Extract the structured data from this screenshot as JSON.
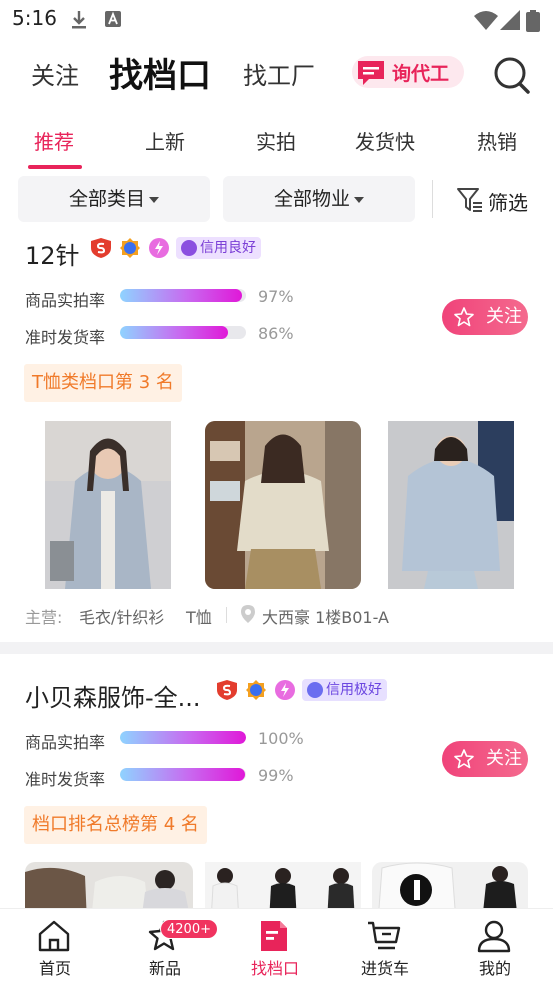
{
  "status": {
    "time": "5:16"
  },
  "topnav": {
    "follow": "关注",
    "find_stall": "找档口",
    "find_factory": "找工厂",
    "inquiry_agent": "询代工"
  },
  "tabs": [
    "推荐",
    "上新",
    "实拍",
    "发货快",
    "热销"
  ],
  "active_tab": "推荐",
  "filters": {
    "category": "全部类目",
    "property": "全部物业",
    "screen": "筛选"
  },
  "shops": [
    {
      "name": "12针",
      "credit": "信用良好",
      "metrics": [
        {
          "label": "商品实拍率",
          "value": "97%",
          "level": 0.97
        },
        {
          "label": "准时发货率",
          "value": "86%",
          "level": 0.86
        }
      ],
      "follow_label": "关注",
      "rank": "T恤类档口第 3 名",
      "main_prefix": "主营:",
      "main_categories": "毛衣/针织衫",
      "main_categories_2": "T恤",
      "location": "大西豪 1楼B01-A"
    },
    {
      "name": "小贝森服饰-全...",
      "credit": "信用极好",
      "metrics": [
        {
          "label": "商品实拍率",
          "value": "100%",
          "level": 1.0
        },
        {
          "label": "准时发货率",
          "value": "99%",
          "level": 0.99
        }
      ],
      "follow_label": "关注",
      "rank": "档口排名总榜第 4 名"
    }
  ],
  "bottomnav": [
    {
      "label": "首页",
      "icon": "home-icon"
    },
    {
      "label": "新品",
      "icon": "star-icon",
      "badge": "4200+"
    },
    {
      "label": "找档口",
      "icon": "stall-icon"
    },
    {
      "label": "进货车",
      "icon": "cart-icon"
    },
    {
      "label": "我的",
      "icon": "user-icon"
    }
  ],
  "colors": {
    "accent": "#e8245a",
    "rank_text": "#f07a2a",
    "credit_text": "#7b3fd6"
  }
}
